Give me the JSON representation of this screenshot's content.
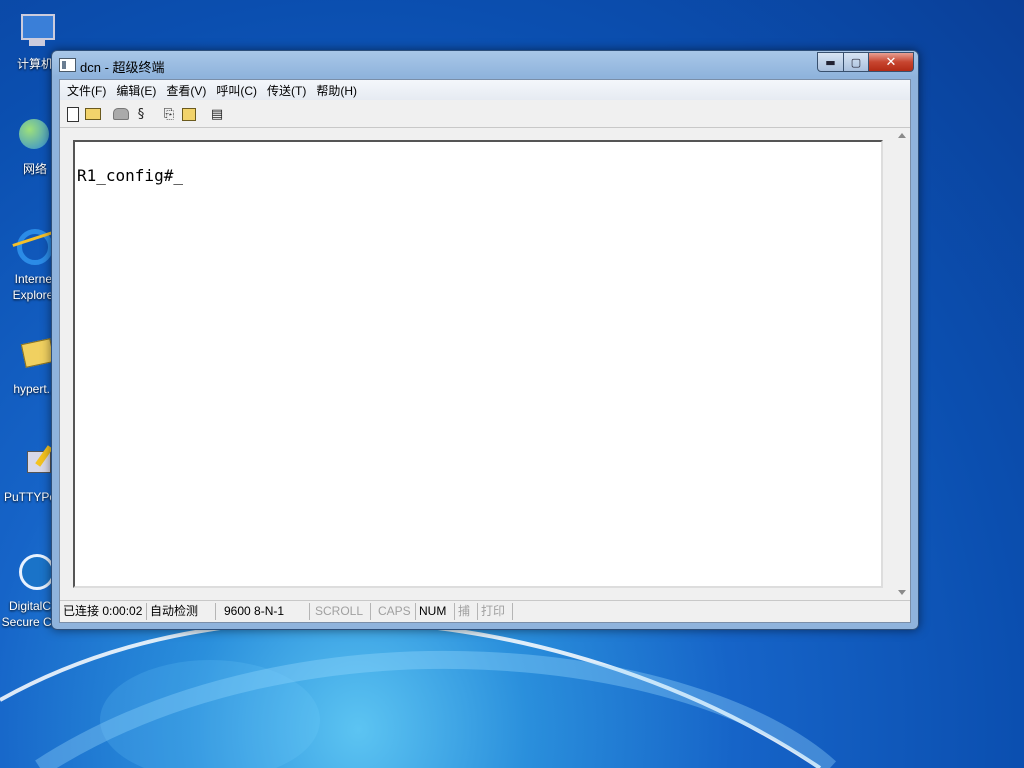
{
  "desktop": {
    "icons": [
      {
        "id": "computer",
        "label": "计算机"
      },
      {
        "id": "network",
        "label": "网络"
      },
      {
        "id": "ie",
        "label": "Internet\nExplorer"
      },
      {
        "id": "hyperterminal",
        "label": "hypert..."
      },
      {
        "id": "putty",
        "label": "PuTTYPo..."
      },
      {
        "id": "digital",
        "label": "DigitalC...\nSecure Co..."
      }
    ]
  },
  "window": {
    "title": "dcn - 超级终端",
    "caption_buttons": {
      "minimize": "▬",
      "maximize": "▢",
      "close": "✕"
    },
    "menu": [
      "文件(F)",
      "编辑(E)",
      "查看(V)",
      "呼叫(C)",
      "传送(T)",
      "帮助(H)"
    ],
    "terminal": {
      "line": "R1_config#_"
    },
    "status": [
      {
        "text": "已连接 0:00:02",
        "dim": false
      },
      {
        "text": "自动检测",
        "dim": false
      },
      {
        "text": "9600 8-N-1",
        "dim": false
      },
      {
        "text": "SCROLL",
        "dim": true
      },
      {
        "text": "CAPS",
        "dim": true
      },
      {
        "text": "NUM",
        "dim": false
      },
      {
        "text": "捕",
        "dim": true
      },
      {
        "text": "打印",
        "dim": true
      }
    ]
  },
  "colors": {
    "desktop": "#1664c8",
    "close_button": "#c7452f"
  }
}
